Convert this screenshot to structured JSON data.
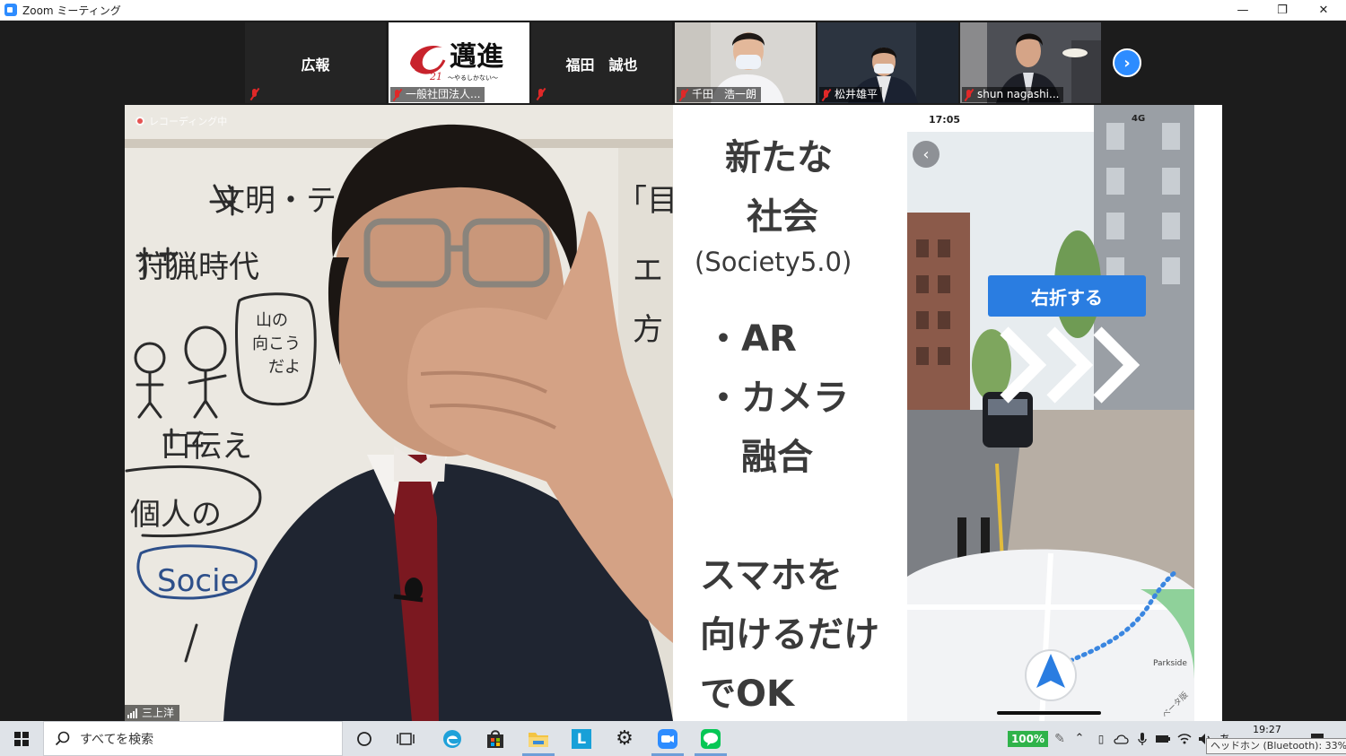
{
  "window": {
    "title": "Zoom ミーティング",
    "controls": {
      "minimize": "—",
      "maximize": "❐",
      "close": "✕"
    }
  },
  "gallery": {
    "tiles": [
      {
        "center_name": "広報",
        "label": ""
      },
      {
        "center_name": "",
        "label": "一般社団法人..."
      },
      {
        "center_name": "福田　誠也",
        "label": ""
      },
      {
        "center_name": "",
        "label": "千田　浩一朗"
      },
      {
        "center_name": "",
        "label": "松井雄平"
      },
      {
        "center_name": "",
        "label": "shun nagashi..."
      }
    ],
    "next_page": "›"
  },
  "speaker": {
    "recording_label": "レコーディング中",
    "name": "三上洋"
  },
  "slide": {
    "heading_line1": "新たな",
    "heading_line2": "社会",
    "heading_line3": "(Society5.0)",
    "bullet1": "・AR",
    "bullet2": "・カメラ",
    "bullet2_cont": "融合",
    "caption_line1": "スマホを",
    "caption_line2": "向けるだけ",
    "caption_line3": "でOK"
  },
  "phone": {
    "time": "17:05",
    "network": "4G",
    "turn_label": "右折する",
    "map_label": "Parkside",
    "beta": "ベータ版"
  },
  "taskbar": {
    "search_placeholder": "すべてを検索",
    "battery_percent": "100%",
    "ime": "あ",
    "time": "19:27",
    "tooltip": "ヘッドホン (Bluetooth): 33%"
  },
  "colors": {
    "zoom_blue": "#2d8cff",
    "mic_off_red": "#e02828",
    "turn_banner": "#2a7de1"
  }
}
